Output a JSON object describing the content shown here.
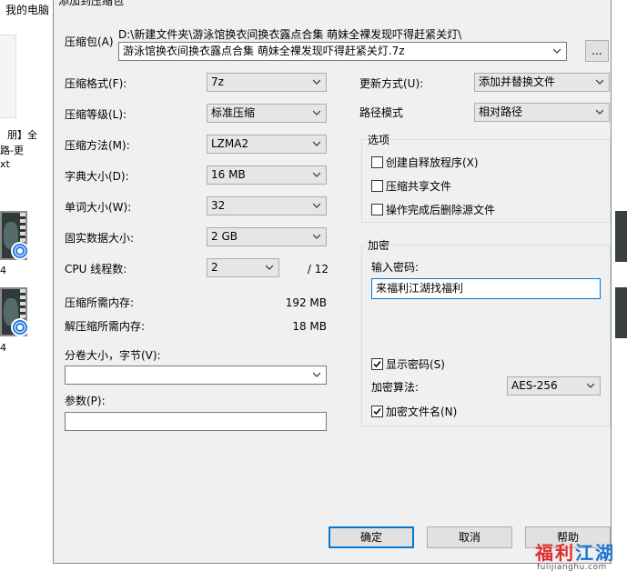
{
  "background": {
    "explorer_title": "我的电脑",
    "file_text_line1": "朋】全",
    "file_text_line2": "路-更",
    "file_text_line3": "xt",
    "video1_label": "4",
    "video2_label": "4"
  },
  "dialog": {
    "title": "添加到压缩包",
    "archive": {
      "label": "压缩包(A)",
      "path": "D:\\新建文件夹\\游泳馆换衣间换衣露点合集 萌妹全裸发现吓得赶紧关灯\\",
      "filename": "游泳馆换衣间换衣露点合集 萌妹全裸发现吓得赶紧关灯.7z",
      "browse_label": "..."
    },
    "left": {
      "format_label": "压缩格式(F):",
      "format_value": "7z",
      "level_label": "压缩等级(L):",
      "level_value": "标准压缩",
      "method_label": "压缩方法(M):",
      "method_value": "LZMA2",
      "dict_label": "字典大小(D):",
      "dict_value": "16 MB",
      "word_label": "单词大小(W):",
      "word_value": "32",
      "solid_label": "固实数据大小:",
      "solid_value": "2 GB",
      "cpu_label": "CPU 线程数:",
      "cpu_value": "2",
      "cpu_total": "/ 12",
      "mem_compress_label": "压缩所需内存:",
      "mem_compress_value": "192 MB",
      "mem_decompress_label": "解压缩所需内存:",
      "mem_decompress_value": "18 MB",
      "split_label": "分卷大小，字节(V):",
      "split_value": "",
      "params_label": "参数(P):",
      "params_value": ""
    },
    "right": {
      "update_label": "更新方式(U):",
      "update_value": "添加并替换文件",
      "path_label": "路径模式",
      "path_value": "相对路径",
      "options_title": "选项",
      "opt_sfx": "创建自释放程序(X)",
      "opt_shared": "压缩共享文件",
      "opt_delete": "操作完成后删除源文件",
      "encryption_title": "加密",
      "password_label": "输入密码:",
      "password_value": "来福利江湖找福利",
      "show_password": "显示密码(S)",
      "enc_method_label": "加密算法:",
      "enc_method_value": "AES-256",
      "enc_names": "加密文件名(N)"
    },
    "buttons": {
      "ok": "确定",
      "cancel": "取消",
      "help": "帮助"
    }
  },
  "watermark": {
    "chars": [
      "福",
      "利",
      "江",
      "湖"
    ],
    "domain": "fulijianghu.com"
  }
}
